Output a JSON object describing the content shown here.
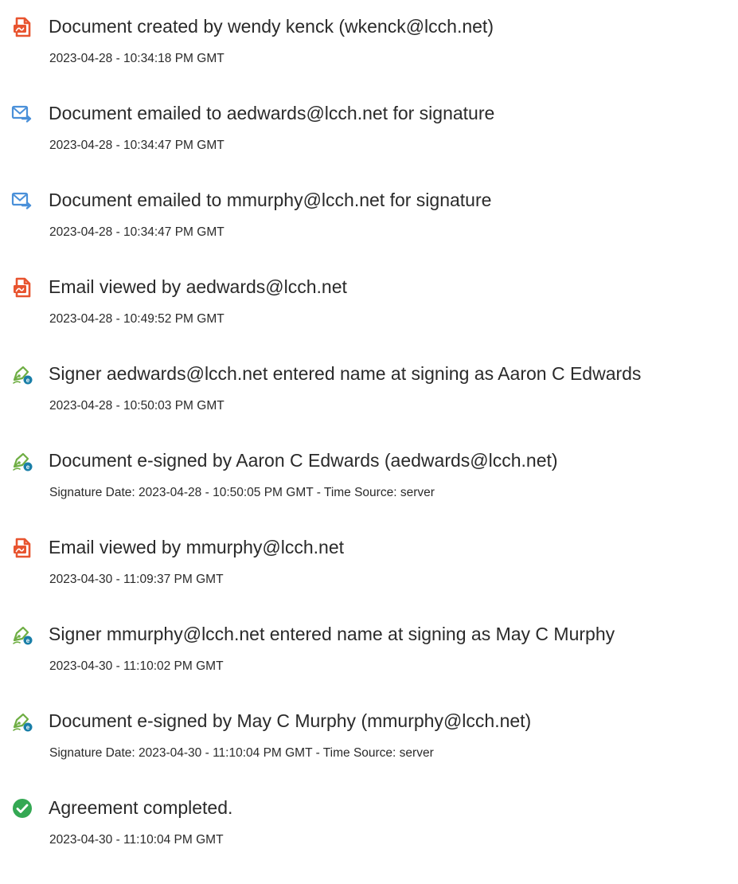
{
  "colors": {
    "pdf_icon": "#e8542f",
    "email_icon": "#4a90d9",
    "sign_icon": "#6fae44",
    "sign_badge": "#1a7fa8",
    "check_icon": "#34a853"
  },
  "events": [
    {
      "icon": "pdf-document-icon",
      "title": "Document created by wendy kenck (wkenck@lcch.net)",
      "time": "2023-04-28 - 10:34:18 PM GMT"
    },
    {
      "icon": "email-sent-icon",
      "title": "Document emailed to aedwards@lcch.net for signature",
      "time": "2023-04-28 - 10:34:47 PM GMT"
    },
    {
      "icon": "email-sent-icon",
      "title": "Document emailed to mmurphy@lcch.net for signature",
      "time": "2023-04-28 - 10:34:47 PM GMT"
    },
    {
      "icon": "pdf-document-icon",
      "title": "Email viewed by aedwards@lcch.net",
      "time": "2023-04-28 - 10:49:52 PM GMT"
    },
    {
      "icon": "e-sign-pen-icon",
      "title": "Signer aedwards@lcch.net entered name at signing as Aaron C Edwards",
      "time": "2023-04-28 - 10:50:03 PM GMT"
    },
    {
      "icon": "e-sign-pen-icon",
      "title": "Document e-signed by Aaron C Edwards (aedwards@lcch.net)",
      "time": "Signature Date: 2023-04-28 - 10:50:05 PM GMT - Time Source: server"
    },
    {
      "icon": "pdf-document-icon",
      "title": "Email viewed by mmurphy@lcch.net",
      "time": "2023-04-30 - 11:09:37 PM GMT"
    },
    {
      "icon": "e-sign-pen-icon",
      "title": "Signer mmurphy@lcch.net entered name at signing as May C Murphy",
      "time": "2023-04-30 - 11:10:02 PM GMT"
    },
    {
      "icon": "e-sign-pen-icon",
      "title": "Document e-signed by May C Murphy (mmurphy@lcch.net)",
      "time": "Signature Date: 2023-04-30 - 11:10:04 PM GMT - Time Source: server"
    },
    {
      "icon": "check-circle-icon",
      "title": "Agreement completed.",
      "time": "2023-04-30 - 11:10:04 PM GMT"
    }
  ]
}
